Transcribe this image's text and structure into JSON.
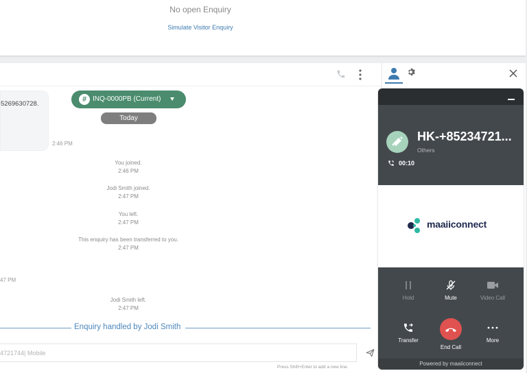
{
  "top_panel": {
    "empty_text": "No open Enquiry",
    "simulate_link": "Simulate Visitor Enquiry"
  },
  "chat": {
    "message_text": "5269630728.",
    "message_time": "2:46 PM",
    "enquiry_pill": "INQ-0000PB (Current)",
    "date_separator": "Today",
    "system_events": [
      {
        "text": "You joined.",
        "time": "2:46 PM"
      },
      {
        "text": "Jodi Smith joined.",
        "time": "2:47 PM"
      },
      {
        "text": "You left.",
        "time": "2:47 PM"
      },
      {
        "text": "This enquiry has been transferred to you.",
        "time": "2:47 PM"
      },
      {
        "text": "Jodi Smith left.",
        "time": "2:47 PM"
      }
    ],
    "orphan_time": "47 PM",
    "handled_by": "Enquiry handled by Jodi Smith",
    "composer_placeholder": "4721744| Mobile",
    "composer_hint": "Press Shift+Enter to add a new line."
  },
  "call_widget": {
    "caller_name": "HK-+85234721...",
    "caller_type": "Others",
    "duration": "00:10",
    "brand": "maaiiconnect",
    "controls": [
      {
        "label": "Hold",
        "icon": "pause-icon",
        "enabled": false
      },
      {
        "label": "Mute",
        "icon": "mic-off-icon",
        "enabled": true
      },
      {
        "label": "Video Call",
        "icon": "video-camera-icon",
        "enabled": false
      },
      {
        "label": "Transfer",
        "icon": "phone-transfer-icon",
        "enabled": true
      },
      {
        "label": "End Call",
        "icon": "phone-hangup-icon",
        "enabled": true
      },
      {
        "label": "More",
        "icon": "ellipsis-icon",
        "enabled": true
      }
    ],
    "powered_by": "Powered by maaiiconnect"
  },
  "colors": {
    "enquiry_pill": "#4a8c6d",
    "link_blue": "#3d7bb0",
    "widget_dark": "#43484c",
    "end_call_red": "#e05250"
  }
}
